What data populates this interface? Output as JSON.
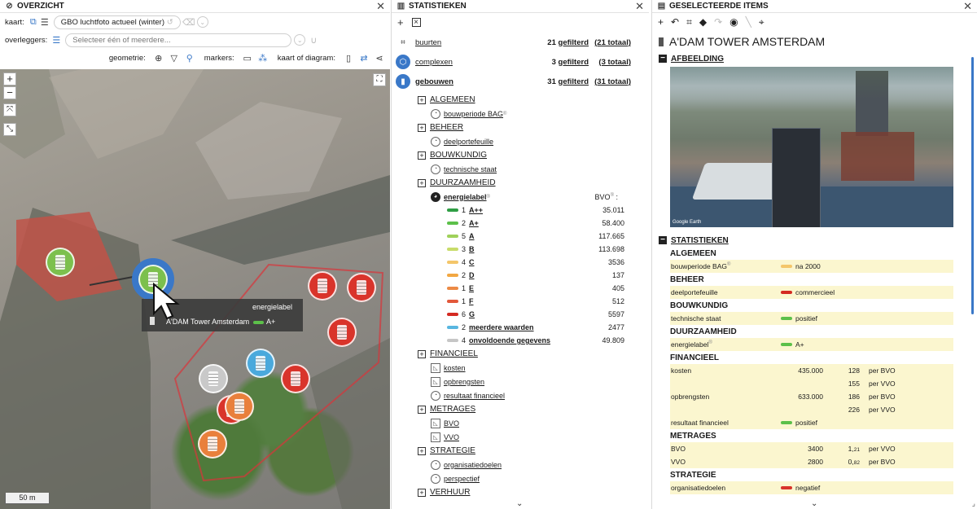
{
  "overzicht": {
    "title": "OVERZICHT",
    "kaart_label": "kaart:",
    "kaart_value": "GBO luchtfoto actueel (winter)",
    "overleggers_label": "overleggers:",
    "overleggers_placeholder": "Selecteer één of meerdere...",
    "geometrie_label": "geometrie:",
    "markers_label": "markers:",
    "kaart_diagram_label": "kaart of diagram:",
    "scale": "50 m",
    "tooltip": {
      "header": "energielabel",
      "name": "A'DAM Tower Amsterdam",
      "value": "A+",
      "value_color": "#5cc04a"
    },
    "marker_colors": {
      "green": "#7cc04d",
      "selected_ring": "#3a78c8",
      "red": "#d9342b",
      "orange": "#e9803c",
      "blue": "#4aa9dc",
      "gray": "#c9c9c9"
    }
  },
  "statistieken": {
    "title": "STATISTIEKEN",
    "summary": [
      {
        "label": "buurten",
        "count": "21",
        "filtered": "gefilterd",
        "total": "(21 totaal)",
        "bold": false
      },
      {
        "label": "complexen",
        "count": "3",
        "filtered": "gefilterd",
        "total": "(3 totaal)",
        "bold": false
      },
      {
        "label": "gebouwen",
        "count": "31",
        "filtered": "gefilterd",
        "total": "(31 totaal)",
        "bold": true
      }
    ],
    "categories": {
      "algemeen": "ALGEMEEN",
      "bouwperiode": "bouwperiode BAG",
      "beheer": "BEHEER",
      "deelportefeuille": "deelportefeuille",
      "bouwkundig": "BOUWKUNDIG",
      "technische_staat": "technische staat",
      "duurzaamheid": "DUURZAAMHEID",
      "energielabel": "energielabel",
      "bvo_header": "BVO",
      "financieel": "FINANCIEEL",
      "kosten": "kosten",
      "opbrengsten": "opbrengsten",
      "resultaat": "resultaat financieel",
      "metrages": "METRAGES",
      "bvo": "BVO",
      "vvo": "VVO",
      "strategie": "STRATEGIE",
      "organisatiedoelen": "organisatiedoelen",
      "perspectief": "perspectief",
      "verhuur": "VERHUUR"
    },
    "energielabels": [
      {
        "n": "1",
        "label": "A++",
        "value": "35.011",
        "color": "#2f9e44"
      },
      {
        "n": "2",
        "label": "A+",
        "value": "58.400",
        "color": "#5cc04a"
      },
      {
        "n": "5",
        "label": "A",
        "value": "117.665",
        "color": "#9fd15a"
      },
      {
        "n": "3",
        "label": "B",
        "value": "113.698",
        "color": "#c8dc6a"
      },
      {
        "n": "4",
        "label": "C",
        "value": "3536",
        "color": "#f4c66a"
      },
      {
        "n": "2",
        "label": "D",
        "value": "137",
        "color": "#f2a742"
      },
      {
        "n": "1",
        "label": "E",
        "value": "405",
        "color": "#ec8a45"
      },
      {
        "n": "1",
        "label": "F",
        "value": "512",
        "color": "#e2583a"
      },
      {
        "n": "6",
        "label": "G",
        "value": "5597",
        "color": "#d42a22"
      },
      {
        "n": "2",
        "label": "meerdere waarden",
        "value": "2477",
        "color": "#58b6e0"
      },
      {
        "n": "4",
        "label": "onvoldoende gegevens",
        "value": "49.809",
        "color": "#c6c6c6"
      }
    ]
  },
  "geselecteerde": {
    "title": "GESELECTEERDE ITEMS",
    "item_title": "A'DAM TOWER AMSTERDAM",
    "afbeelding": "AFBEELDING",
    "statistieken": "STATISTIEKEN",
    "image_credit": "Google Earth",
    "groups": {
      "algemeen": "ALGEMEEN",
      "beheer": "BEHEER",
      "bouwkundig": "BOUWKUNDIG",
      "duurzaamheid": "DUURZAAMHEID",
      "financieel": "FINANCIEEL",
      "metrages": "METRAGES",
      "strategie": "STRATEGIE"
    },
    "rows": {
      "bouwperiode": {
        "key": "bouwperiode BAG",
        "value": "na 2000",
        "color": "#f4c66a"
      },
      "deelportefeuille": {
        "key": "deelportefeuille",
        "value": "commercieel",
        "color": "#d42a22"
      },
      "technische_staat": {
        "key": "technische staat",
        "value": "positief",
        "color": "#5cc04a"
      },
      "energielabel": {
        "key": "energielabel",
        "value": "A+",
        "color": "#5cc04a"
      },
      "kosten": {
        "key": "kosten",
        "amount": "435.000",
        "v1": "128",
        "u1": "per BVO",
        "v2": "155",
        "u2": "per VVO"
      },
      "opbrengsten": {
        "key": "opbrengsten",
        "amount": "633.000",
        "v1": "186",
        "u1": "per BVO",
        "v2": "226",
        "u2": "per VVO"
      },
      "resultaat": {
        "key": "resultaat financieel",
        "value": "positief",
        "color": "#5cc04a"
      },
      "bvo": {
        "key": "BVO",
        "amount": "3400",
        "ratio_int": "1,",
        "ratio_dec": "21",
        "unit": "per VVO"
      },
      "vvo": {
        "key": "VVO",
        "amount": "2800",
        "ratio_int": "0,",
        "ratio_dec": "82",
        "unit": "per BVO"
      },
      "organisatiedoelen": {
        "key": "organisatiedoelen",
        "value": "negatief",
        "color": "#d9342b"
      }
    }
  }
}
